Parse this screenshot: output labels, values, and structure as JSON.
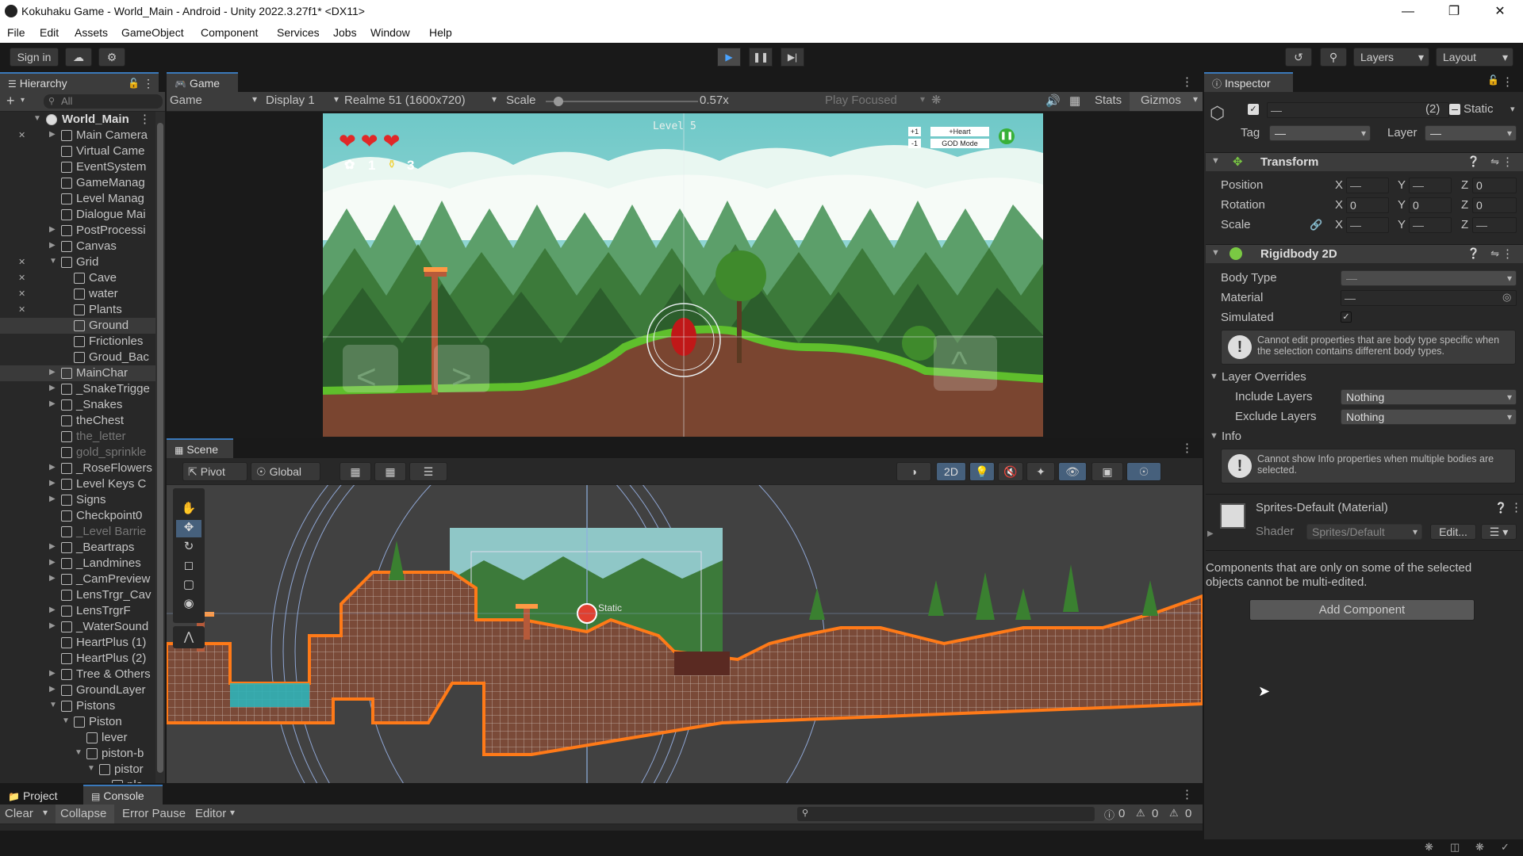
{
  "window": {
    "title": "Kokuhaku Game - World_Main - Android - Unity 2022.3.27f1* <DX11>"
  },
  "menu": [
    "File",
    "Edit",
    "Assets",
    "GameObject",
    "Component",
    "Services",
    "Jobs",
    "Window",
    "Help"
  ],
  "toolbar": {
    "sign_in": "Sign in",
    "layers": "Layers",
    "layout": "Layout"
  },
  "hierarchy": {
    "tab": "Hierarchy",
    "search_placeholder": "All",
    "scene": "World_Main",
    "rows": [
      {
        "label": "Main Camera",
        "indent": 1,
        "arrow": true
      },
      {
        "label": "Virtual Came",
        "indent": 1,
        "arrow": false
      },
      {
        "label": "EventSystem",
        "indent": 1,
        "arrow": false
      },
      {
        "label": "GameManag",
        "indent": 1,
        "arrow": false
      },
      {
        "label": "Level Manag",
        "indent": 1,
        "arrow": false
      },
      {
        "label": "Dialogue Mai",
        "indent": 1,
        "arrow": false
      },
      {
        "label": "PostProcessi",
        "indent": 1,
        "arrow": true
      },
      {
        "label": "Canvas",
        "indent": 1,
        "arrow": true
      },
      {
        "label": "Grid",
        "indent": 1,
        "arrow": true,
        "open": true
      },
      {
        "label": "Cave",
        "indent": 2,
        "arrow": false
      },
      {
        "label": "water",
        "indent": 2,
        "arrow": false
      },
      {
        "label": "Plants",
        "indent": 2,
        "arrow": false
      },
      {
        "label": "Ground",
        "indent": 2,
        "arrow": false,
        "sel": true
      },
      {
        "label": "Frictionles",
        "indent": 2,
        "arrow": false
      },
      {
        "label": "Groud_Bac",
        "indent": 2,
        "arrow": false
      },
      {
        "label": "MainChar",
        "indent": 1,
        "arrow": true,
        "sel": true
      },
      {
        "label": "_SnakeTrigge",
        "indent": 1,
        "arrow": true
      },
      {
        "label": "_Snakes",
        "indent": 1,
        "arrow": true
      },
      {
        "label": "theChest",
        "indent": 1,
        "arrow": false
      },
      {
        "label": "the_letter",
        "indent": 1,
        "arrow": false,
        "dim": true
      },
      {
        "label": "gold_sprinkle",
        "indent": 1,
        "arrow": false,
        "dim": true
      },
      {
        "label": "_RoseFlowers",
        "indent": 1,
        "arrow": true
      },
      {
        "label": "Level Keys C",
        "indent": 1,
        "arrow": true
      },
      {
        "label": "Signs",
        "indent": 1,
        "arrow": true
      },
      {
        "label": "Checkpoint0",
        "indent": 1,
        "arrow": false
      },
      {
        "label": "_Level Barrie",
        "indent": 1,
        "arrow": false,
        "dim": true
      },
      {
        "label": "_Beartraps",
        "indent": 1,
        "arrow": true
      },
      {
        "label": "_Landmines",
        "indent": 1,
        "arrow": true
      },
      {
        "label": "_CamPreview",
        "indent": 1,
        "arrow": true
      },
      {
        "label": "LensTrgr_Cav",
        "indent": 1,
        "arrow": false
      },
      {
        "label": "LensTrgrF",
        "indent": 1,
        "arrow": true
      },
      {
        "label": "_WaterSound",
        "indent": 1,
        "arrow": true
      },
      {
        "label": "HeartPlus (1)",
        "indent": 1,
        "arrow": false
      },
      {
        "label": "HeartPlus (2)",
        "indent": 1,
        "arrow": false
      },
      {
        "label": "Tree & Others",
        "indent": 1,
        "arrow": true
      },
      {
        "label": "GroundLayer",
        "indent": 1,
        "arrow": true
      },
      {
        "label": "Pistons",
        "indent": 1,
        "arrow": true,
        "open": true
      },
      {
        "label": "Piston",
        "indent": 2,
        "arrow": true,
        "open": true
      },
      {
        "label": "lever",
        "indent": 3,
        "arrow": false
      },
      {
        "label": "piston-b",
        "indent": 3,
        "arrow": true,
        "open": true
      },
      {
        "label": "pistor",
        "indent": 4,
        "arrow": true,
        "open": true
      },
      {
        "label": "pla",
        "indent": 5,
        "arrow": false
      }
    ]
  },
  "game": {
    "tab": "Game",
    "mode": "Game",
    "display": "Display 1",
    "resolution": "Realme 51 (1600x720)",
    "scale_label": "Scale",
    "scale_value": "0.57x",
    "scale_fraction": 0.05,
    "play_focused": "Play Focused",
    "stats": "Stats",
    "gizmos": "Gizmos",
    "hud": {
      "level": "Level 5",
      "hearts": 3,
      "plants": "1",
      "keys": "3",
      "plus_one": "+1",
      "minus_one": "-1",
      "plus_heart": "+Heart",
      "god_mode": "GOD Mode"
    }
  },
  "scene": {
    "tab": "Scene",
    "pivot": "Pivot",
    "global": "Global",
    "mode2d": "2D",
    "static_label": "Static"
  },
  "inspector": {
    "tab": "Inspector",
    "multi_count": "(2)",
    "static": "Static",
    "tag_label": "Tag",
    "layer_label": "Layer",
    "dash": "—",
    "transform": {
      "title": "Transform",
      "position": "Position",
      "rotation": "Rotation",
      "scale": "Scale",
      "pos_z": "0",
      "rot_x": "0",
      "rot_y": "0",
      "rot_z": "0",
      "x": "X",
      "y": "Y",
      "z": "Z"
    },
    "rigidbody": {
      "title": "Rigidbody 2D",
      "body_type": "Body Type",
      "material": "Material",
      "simulated": "Simulated",
      "help1": "Cannot edit properties that are body type specific when the selection contains different body types.",
      "layer_overrides": "Layer Overrides",
      "include_layers": "Include Layers",
      "exclude_layers": "Exclude Layers",
      "include_value": "Nothing",
      "exclude_value": "Nothing",
      "info": "Info",
      "help2": "Cannot show Info properties when multiple bodies are selected."
    },
    "material": {
      "title": "Sprites-Default (Material)",
      "shader_label": "Shader",
      "shader_value": "Sprites/Default",
      "edit": "Edit..."
    },
    "note": "Components that are only on some of the selected objects cannot be multi-edited.",
    "add_component": "Add Component"
  },
  "console": {
    "project_tab": "Project",
    "console_tab": "Console",
    "clear": "Clear",
    "collapse": "Collapse",
    "error_pause": "Error Pause",
    "editor": "Editor",
    "count_log": "0",
    "count_warn": "0",
    "count_err": "0"
  },
  "colors": {
    "accent": "#3a79bb",
    "sky": "#9fdde8",
    "forest": "#3c7a3a",
    "grass": "#5fbf2c",
    "dirt": "#6e3a26",
    "collider": "#ff7a18"
  }
}
